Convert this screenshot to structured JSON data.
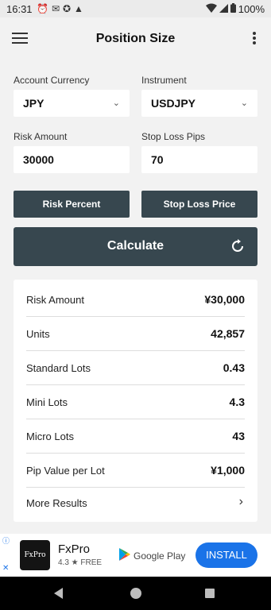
{
  "status_bar": {
    "time": "16:31",
    "battery": "100%"
  },
  "app_bar": {
    "title": "Position Size"
  },
  "form": {
    "account_currency": {
      "label": "Account Currency",
      "value": "JPY"
    },
    "instrument": {
      "label": "Instrument",
      "value": "USDJPY"
    },
    "risk_amount": {
      "label": "Risk Amount",
      "value": "30000"
    },
    "stop_loss_pips": {
      "label": "Stop Loss Pips",
      "value": "70"
    },
    "risk_percent_button": "Risk Percent",
    "stop_loss_price_button": "Stop Loss Price",
    "calculate_button": "Calculate"
  },
  "results": {
    "rows": [
      {
        "label": "Risk Amount",
        "value": "¥30,000"
      },
      {
        "label": "Units",
        "value": "42,857"
      },
      {
        "label": "Standard Lots",
        "value": "0.43"
      },
      {
        "label": "Mini Lots",
        "value": "4.3"
      },
      {
        "label": "Micro Lots",
        "value": "43"
      },
      {
        "label": "Pip Value per Lot",
        "value": "¥1,000"
      }
    ],
    "more_label": "More Results"
  },
  "ad": {
    "logo_text": "FxPro",
    "name": "FxPro",
    "rating": "4.3 ★  FREE",
    "store": "Google Play",
    "install": "INSTALL"
  },
  "icons": {
    "menu": "hamburger-icon",
    "more": "more-vert-icon",
    "refresh": "refresh-icon",
    "chevron": "chevron-down-icon"
  }
}
